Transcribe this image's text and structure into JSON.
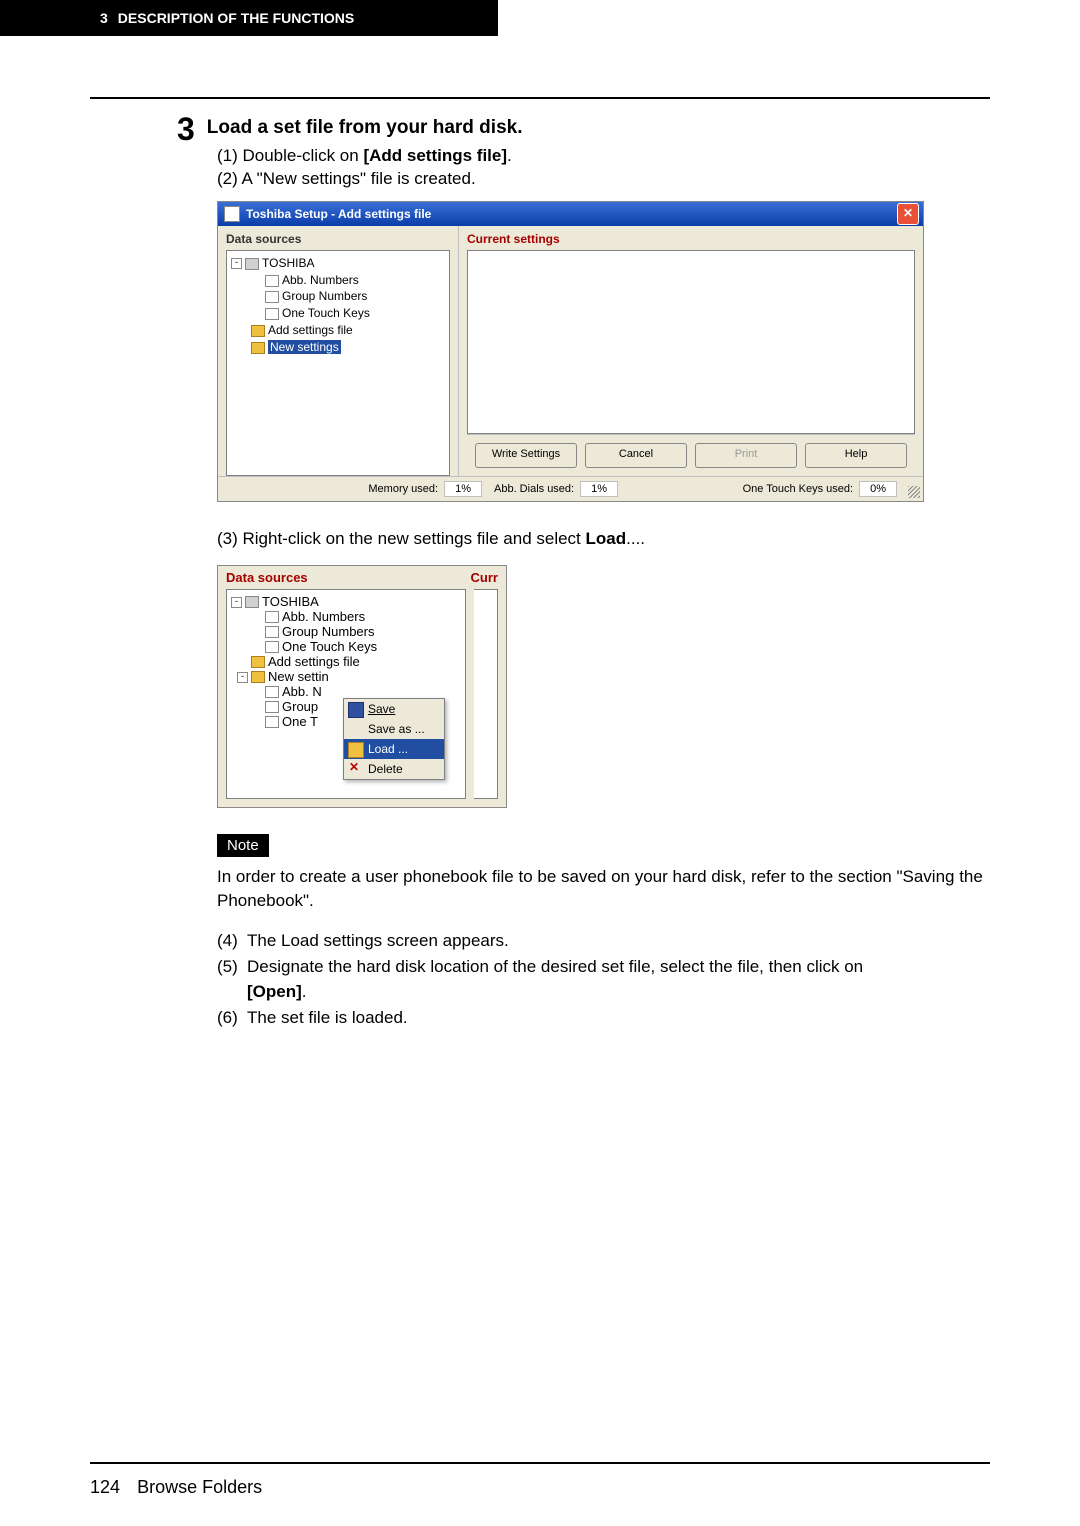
{
  "header": {
    "chapter": "3",
    "title": "DESCRIPTION OF THE FUNCTIONS"
  },
  "step": {
    "number": "3",
    "title": "Load a set file from your hard disk.",
    "line1_prefix": "(1) Double-click on ",
    "line1_bold": "[Add settings file]",
    "line1_suffix": ".",
    "line2": "(2) A \"New settings\" file is created."
  },
  "dialog1": {
    "title": "Toshiba Setup - Add settings file",
    "left_label": "Data sources",
    "right_label": "Current settings",
    "tree": {
      "root": "TOSHIBA",
      "items": [
        "Abb. Numbers",
        "Group Numbers",
        "One Touch Keys"
      ],
      "add": "Add settings file",
      "selected": "New settings"
    },
    "buttons": {
      "write": "Write Settings",
      "cancel": "Cancel",
      "print": "Print",
      "help": "Help"
    },
    "status": {
      "mem_lbl": "Memory used:",
      "mem_val": "1%",
      "abb_lbl": "Abb. Dials used:",
      "abb_val": "1%",
      "otk_lbl": "One Touch Keys used:",
      "otk_val": "0%"
    }
  },
  "step3_prefix": "(3) Right-click on the new settings file and select ",
  "step3_bold": "Load",
  "step3_suffix": "....",
  "dialog2": {
    "left_label": "Data sources",
    "right_label": "Curr",
    "tree": {
      "root": "TOSHIBA",
      "items": [
        "Abb. Numbers",
        "Group Numbers",
        "One Touch Keys"
      ],
      "add": "Add settings file",
      "new": "New settin",
      "subitems": [
        "Abb. N",
        "Group",
        "One T"
      ]
    },
    "menu": {
      "save": "Save",
      "saveas": "Save as ...",
      "load": "Load ...",
      "delete": "Delete"
    }
  },
  "note": {
    "label": "Note",
    "body": "In order to create a user phonebook file to be saved on your hard disk, refer to the section \"Saving the Phonebook\"."
  },
  "cont": {
    "i4": "The Load settings screen appears.",
    "i5_prefix": "Designate the hard disk location of the desired set file, select the file, then click on ",
    "i5_bold": "[Open]",
    "i5_suffix": ".",
    "i6": "The set file is loaded."
  },
  "footer": {
    "page": "124",
    "section": "Browse Folders"
  }
}
